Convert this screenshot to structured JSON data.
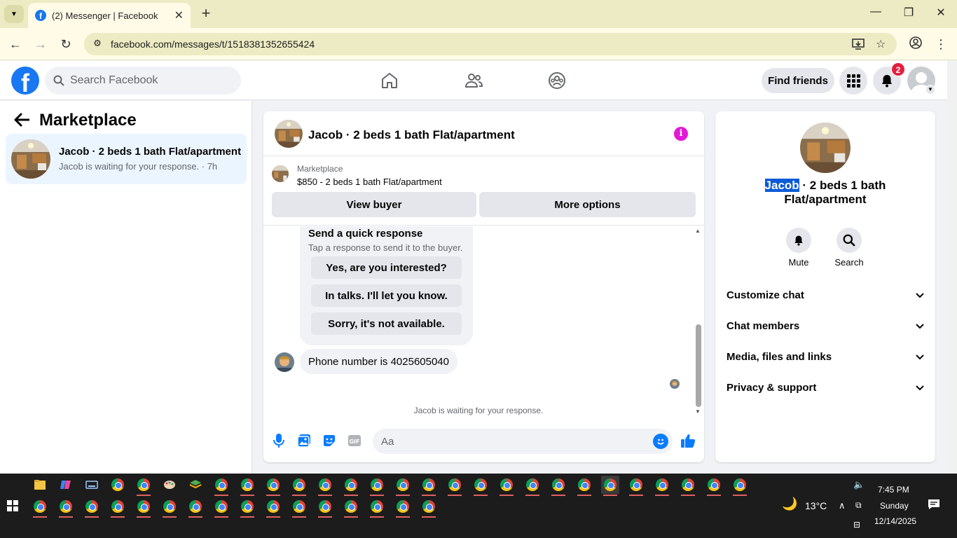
{
  "browser": {
    "tab_title": "(2) Messenger | Facebook",
    "url": "facebook.com/messages/t/1518381352655424"
  },
  "fb": {
    "search_placeholder": "Search Facebook",
    "find_friends": "Find friends",
    "notification_count": "2"
  },
  "sidebar": {
    "title": "Marketplace",
    "conversation": {
      "name": "Jacob · 2 beds 1 bath Flat/apartment",
      "preview": "Jacob is waiting for your response. · 7h"
    }
  },
  "chat": {
    "title": "Jacob · 2 beds 1 bath Flat/apartment",
    "marketplace": {
      "label": "Marketplace",
      "listing": "$850 - 2 beds 1 bath Flat/apartment",
      "view_buyer": "View buyer",
      "more_options": "More options"
    },
    "quick_response": {
      "title": "Send a quick response",
      "subtitle": "Tap a response to send it to the buyer.",
      "options": [
        "Yes, are you interested?",
        "In talks. I'll let you know.",
        "Sorry, it's not available."
      ]
    },
    "message": "Phone number is 4025605040",
    "waiting_note": "Jacob is waiting for your response.",
    "composer_placeholder": "Aa"
  },
  "info_panel": {
    "name_highlight": "Jacob",
    "name_rest": " · 2 beds 1 bath Flat/apartment",
    "actions": [
      "Mute",
      "Search"
    ],
    "sections": [
      "Customize chat",
      "Chat members",
      "Media, files and links",
      "Privacy & support"
    ]
  },
  "taskbar": {
    "weather": "13°C",
    "time": "7:45 PM",
    "day": "Sunday",
    "date": "12/14/2025"
  },
  "colors": {
    "fb_blue": "#1877f2",
    "messenger_blue": "#0a7cff",
    "highlight": "#0a5bd8",
    "info_icon": "#e418d8"
  }
}
